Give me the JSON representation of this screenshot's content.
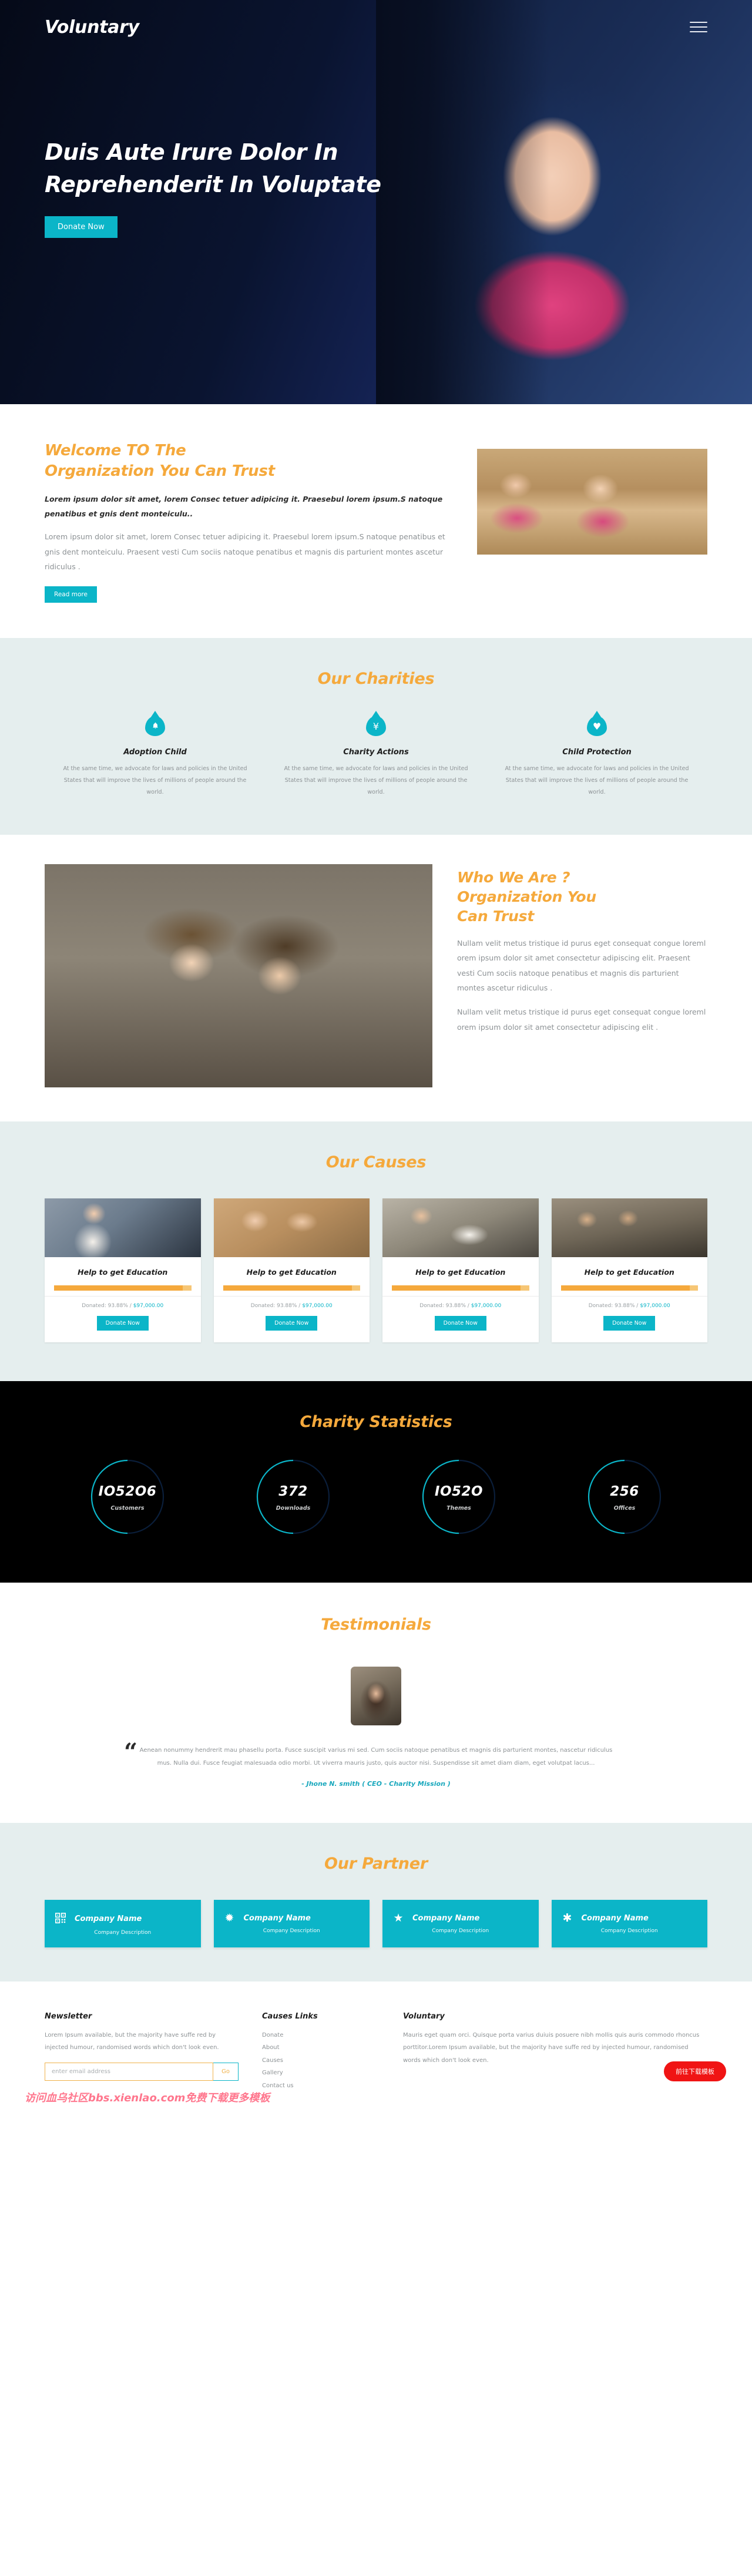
{
  "brand": "Voluntary",
  "nav": {
    "menu_icon": "hamburger-menu-icon"
  },
  "hero": {
    "heading_line1": "Duis Aute Irure Dolor In",
    "heading_line2": "Reprehenderit In Voluptate",
    "cta": "Donate Now"
  },
  "welcome": {
    "heading_line1": "Welcome TO The",
    "heading_line2": "Organization You Can Trust",
    "lead": "Lorem ipsum dolor sit amet, lorem Consec tetuer adipicing it. Praesebul lorem ipsum.S natoque penatibus et gnis dent monteiculu..",
    "paragraph": "Lorem ipsum dolor sit amet, lorem Consec tetuer adipicing it. Praesebul lorem ipsum.S natoque penatibus et gnis dent monteiculu. Praesent vesti Cum sociis natoque penatibus et magnis dis parturient montes ascetur ridiculus .",
    "cta": "Read more"
  },
  "charities": {
    "title": "Our Charities",
    "items": [
      {
        "icon": "bell-icon",
        "glyph": "⌕",
        "title": "Adoption Child",
        "desc": "At the same time, we advocate for laws and policies in the United States that will improve the lives of millions of people around the world."
      },
      {
        "icon": "yen-currency-icon",
        "glyph": "¥",
        "title": "Charity Actions",
        "desc": "At the same time, we advocate for laws and policies in the United States that will improve the lives of millions of people around the world."
      },
      {
        "icon": "heart-icon",
        "glyph": "♥",
        "title": "Child Protection",
        "desc": "At the same time, we advocate for laws and policies in the United States that will improve the lives of millions of people around the world."
      }
    ]
  },
  "whoweare": {
    "heading_line1": "Who We Are ?",
    "heading_line2": "Organization You",
    "heading_line3": "Can Trust",
    "paragraph1": "Nullam velit metus tristique id purus eget consequat congue loreml orem ipsum dolor sit amet consectetur adipiscing elit. Praesent vesti Cum sociis natoque penatibus et magnis dis parturient montes ascetur ridiculus .",
    "paragraph2": "Nullam velit metus tristique id purus eget consequat congue loreml orem ipsum dolor sit amet consectetur adipiscing elit ."
  },
  "causes": {
    "title": "Our Causes",
    "items": [
      {
        "title": "Help to get Education",
        "percent": "93.88%",
        "amount": "$97,000.00",
        "meta_prefix": "Donated: ",
        "cta": "Donate Now",
        "progress": 93.88
      },
      {
        "title": "Help to get Education",
        "percent": "93.88%",
        "amount": "$97,000.00",
        "meta_prefix": "Donated: ",
        "cta": "Donate Now",
        "progress": 93.88
      },
      {
        "title": "Help to get Education",
        "percent": "93.88%",
        "amount": "$97,000.00",
        "meta_prefix": "Donated: ",
        "cta": "Donate Now",
        "progress": 93.88
      },
      {
        "title": "Help to get Education",
        "percent": "93.88%",
        "amount": "$97,000.00",
        "meta_prefix": "Donated: ",
        "cta": "Donate Now",
        "progress": 93.88
      }
    ]
  },
  "stats": {
    "title": "Charity Statistics",
    "items": [
      {
        "value": "IO52O6",
        "label": "Customers"
      },
      {
        "value": "372",
        "label": "Downloads"
      },
      {
        "value": "IO52O",
        "label": "Themes"
      },
      {
        "value": "256",
        "label": "Offices"
      }
    ]
  },
  "testimonials": {
    "title": "Testimonials",
    "quote_mark": "“",
    "quote": "Aenean nonummy hendrerit mau phasellu porta. Fusce suscipit varius mi sed. Cum sociis natoque penatibus et magnis dis parturient montes, nascetur ridiculus mus. Nulla dui. Fusce feugiat malesuada odio morbi. Ut viverra mauris justo, quis auctor nisi. Suspendisse sit amet diam diam, eget volutpat lacus...",
    "author": "- Jhone N. smith ( CEO - Charity Mission )"
  },
  "partners": {
    "title": "Our Partner",
    "items": [
      {
        "icon": "qr-code-icon",
        "glyph": "▒",
        "name": "Company Name",
        "desc": "Company Description"
      },
      {
        "icon": "burst-star-icon",
        "glyph": "✹",
        "name": "Company Name",
        "desc": "Company Description"
      },
      {
        "icon": "star-icon",
        "glyph": "★",
        "name": "Company Name",
        "desc": "Company Description"
      },
      {
        "icon": "asterisk-icon",
        "glyph": "✱",
        "name": "Company Name",
        "desc": "Company Description"
      }
    ]
  },
  "footer": {
    "newsletter": {
      "title": "Newsletter",
      "desc": "Lorem Ipsum available, but the majority have suffe red by injected humour, randomised words which don't look even.",
      "placeholder": "enter email address",
      "value": "",
      "go": "Go"
    },
    "links": {
      "title": "Causes Links",
      "items": [
        "Donate",
        "About",
        "Causes",
        "Gallery",
        "Contact us"
      ]
    },
    "about": {
      "title": "Voluntary",
      "desc": "Mauris eget quam orci. Quisque porta varius duiuis posuere nibh mollis quis auris commodo rhoncus porttitor.Lorem Ipsum available, but the majority have suffe red by injected humour, randomised words which don't look even."
    },
    "watermark": "访问血乌社区bbs.xienlao.com免费下载更多模板",
    "download_button": "前往下载模板"
  },
  "colors": {
    "teal": "#0bb5c8",
    "orange": "#f5a93c",
    "dark": "#000000",
    "mint": "#e5eeee",
    "red": "#f01414"
  }
}
